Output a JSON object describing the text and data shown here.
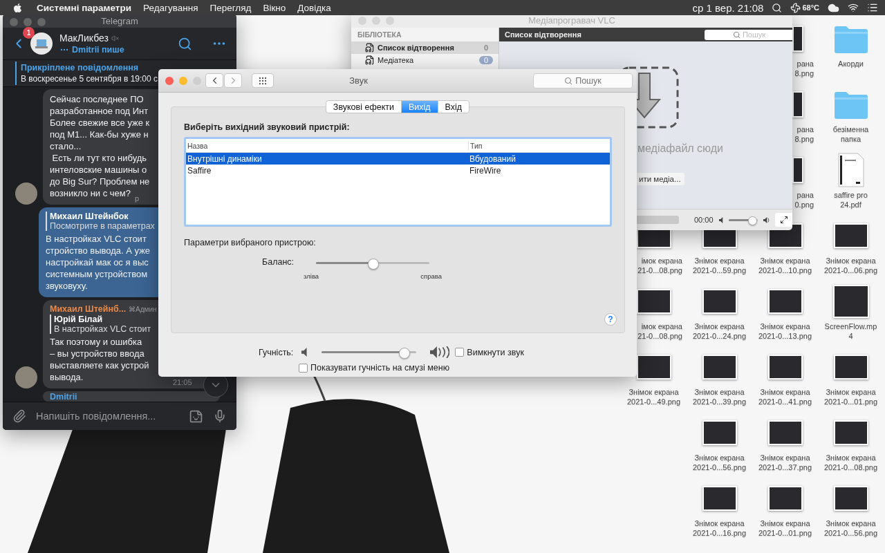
{
  "menu_bar": {
    "app_name": "Системні параметри",
    "menus": [
      "Редагування",
      "Перегляд",
      "Вікно",
      "Довідка"
    ],
    "clock": "ср 1  вер. 21:08",
    "temperature": "68°C"
  },
  "telegram": {
    "title": "Telegram",
    "unread_badge": "1",
    "chat_name": "МакЛикбез",
    "typing": "Dmitrii пише",
    "pinned": {
      "label": "Прикріплене повідомлення",
      "text": "В воскресенье 5 сентября в 19:00 с"
    },
    "messages": [
      {
        "kind": "incoming",
        "avatar": true,
        "text": "Сейчас последнее ПО\nразработанное под Инт\nБолее свежие все уже к\nпод M1... Как-бы хуже н\nстало...\n Есть ли тут кто нибудь\nинтеловские машины о\nдо Big Sur? Проблем не\nвозникло ни с чем?",
        "time": "р"
      },
      {
        "kind": "outgoing",
        "reply": {
          "author": "Михаил Штейнбок",
          "text": "Посмотрите в параметрах"
        },
        "text": "В настройках VLC стоит\nстройство вывода. А уже\nнастройкай мак ос я выс\nсистемным устройством\nзвуковуху."
      },
      {
        "kind": "incoming",
        "avatar": true,
        "author": "Михаил Штейнб...",
        "tag": "⌘Админ",
        "reply": {
          "author": "Юрій Білай",
          "text": "В настройках VLC стоит"
        },
        "text": "Так поэтому и ошибка\n– вы устройство ввода\nвыставляете как устрой\nвывода.",
        "time": "21:05"
      },
      {
        "kind": "incoming",
        "author": "Dmitrii"
      }
    ],
    "input_placeholder": "Напишіть повідомлення..."
  },
  "vlc": {
    "title": "Медіапрогравач VLC",
    "library_heading": "БІБЛІОТЕКА",
    "library": [
      {
        "label": "Список відтворення",
        "count": "0",
        "selected": true
      },
      {
        "label": "Медіатека",
        "count": "0",
        "selected": false
      }
    ],
    "header": "Список відтворення",
    "search_placeholder": "Пошук",
    "drop_hint": "медіафайл сюди",
    "open_button": "ити медіа...",
    "progress": {
      "level": 0
    },
    "time": "00:00",
    "volume": {
      "level": 0.82
    }
  },
  "sound": {
    "title": "Звук",
    "search_placeholder": "Пошук",
    "tabs": [
      {
        "label": "Звукові ефекти",
        "selected": false
      },
      {
        "label": "Вихід",
        "selected": true
      },
      {
        "label": "Вхід",
        "selected": false
      }
    ],
    "prompt": "Виберіть вихідний звуковий пристрій:",
    "columns": [
      "Назва",
      "Тип"
    ],
    "devices": [
      {
        "name": "Внутрішні динаміки",
        "type": "Вбудований",
        "selected": true
      },
      {
        "name": "Saffire",
        "type": "FireWire",
        "selected": false
      }
    ],
    "settings_label": "Параметри вибраного пристрою:",
    "balance": {
      "label": "Баланс:",
      "level": 0.5,
      "left": "зліва",
      "right": "справа"
    },
    "help": "?",
    "volume": {
      "label": "Гучність:",
      "level": 0.87
    },
    "mute": {
      "label": "Вимкнути звук",
      "checked": false
    },
    "show_in_menu_bar": {
      "label": "Показувати гучність на смузі меню",
      "checked": false
    }
  },
  "desktop": {
    "rows": [
      [
        {
          "kind": "image-edge",
          "label": "рана\n8.png"
        },
        {
          "kind": "folder",
          "label": "Акорди"
        }
      ],
      [
        {
          "kind": "image-edge",
          "label": "рана\n8.png"
        },
        {
          "kind": "folder",
          "label": "безіменна\nпапка"
        }
      ],
      [
        {
          "kind": "image-edge",
          "label": "рана\n0.png"
        },
        {
          "kind": "document",
          "label": "saffire pro\n24.pdf"
        }
      ],
      [
        {
          "kind": "image-cut",
          "label": "імок екрана\n21-0...08.png"
        },
        {
          "kind": "image",
          "label": "Знімок екрана\n2021-0...59.png"
        },
        {
          "kind": "image",
          "label": "Знімок екрана\n2021-0...10.png"
        },
        {
          "kind": "image",
          "label": "Знімок екрана\n2021-0...06.png"
        }
      ],
      [
        {
          "kind": "image-cut",
          "label": "імок екрана\n21-0...08.png"
        },
        {
          "kind": "image",
          "label": "Знімок екрана\n2021-0...24.png"
        },
        {
          "kind": "image",
          "label": "Знімок екрана\n2021-0...13.png"
        },
        {
          "kind": "video",
          "label": "ScreenFlow.mp\n4"
        }
      ],
      [
        {
          "kind": "image",
          "label": "Знімок екрана\n2021-0...49.png"
        },
        {
          "kind": "image",
          "label": "Знімок екрана\n2021-0...39.png"
        },
        {
          "kind": "image",
          "label": "Знімок екрана\n2021-0...41.png"
        },
        {
          "kind": "image",
          "label": "Знімок екрана\n2021-0...01.png"
        }
      ],
      [
        {
          "kind": "image",
          "label": "Знімок екрана\n2021-0...56.png"
        },
        {
          "kind": "image",
          "label": "Знімок екрана\n2021-0...37.png"
        },
        {
          "kind": "image",
          "label": "Знімок екрана\n2021-0...08.png"
        }
      ],
      [
        {
          "kind": "image",
          "label": "Знімок екрана\n2021-0...16.png"
        },
        {
          "kind": "image",
          "label": "Знімок екрана\n2021-0...01.png"
        },
        {
          "kind": "image",
          "label": "Знімок екрана\n2021-0...56.png"
        }
      ]
    ]
  }
}
